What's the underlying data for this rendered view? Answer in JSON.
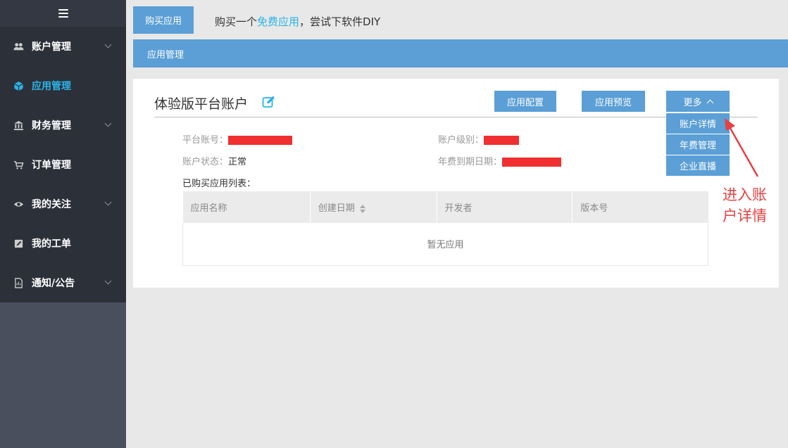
{
  "sidebar": {
    "menu_icon": "hamburger-icon",
    "items": [
      {
        "label": "账户管理",
        "icon": "users-icon",
        "has_submenu": true
      },
      {
        "label": "应用管理",
        "icon": "cube-icon",
        "has_submenu": false,
        "active": true
      },
      {
        "label": "财务管理",
        "icon": "bank-icon",
        "has_submenu": true
      },
      {
        "label": "订单管理",
        "icon": "cart-icon",
        "has_submenu": false
      },
      {
        "label": "我的关注",
        "icon": "eye-icon",
        "has_submenu": true
      },
      {
        "label": "我的工单",
        "icon": "edit-icon",
        "has_submenu": false
      },
      {
        "label": "通知/公告",
        "icon": "document-icon",
        "has_submenu": true
      }
    ]
  },
  "topbar": {
    "buy_label": "购买应用",
    "promo_prefix": "购买一个",
    "promo_link": "免费应用",
    "promo_suffix": "，尝试下软件DIY"
  },
  "section": {
    "title": "应用管理"
  },
  "card": {
    "title": "体验版平台账户",
    "buttons": {
      "config": "应用配置",
      "preview": "应用预览",
      "more": "更多"
    },
    "dropdown": [
      "账户详情",
      "年费管理",
      "企业直播"
    ],
    "info": {
      "account_label": "平台账号：",
      "level_label": "账户级别：",
      "status_label": "账户状态：",
      "status_value": "正常",
      "expiry_label": "年费到期日期："
    },
    "list_title": "已购买应用列表：",
    "table": {
      "columns": [
        "应用名称",
        "创建日期",
        "开发者",
        "版本号"
      ],
      "empty": "暂无应用"
    }
  },
  "annotation": {
    "line1": "进入账",
    "line2": "户详情"
  },
  "colors": {
    "accent": "#5b9fd6",
    "active": "#2bb4e8",
    "annotation": "#e84040",
    "redaction": "#f03030"
  }
}
